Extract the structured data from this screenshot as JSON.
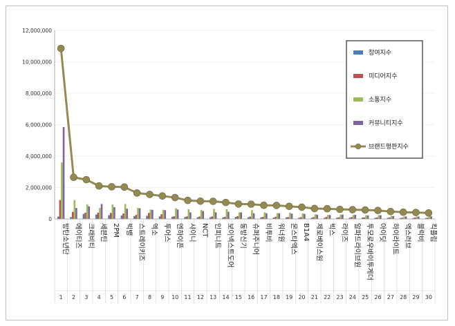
{
  "chart_data": {
    "type": "bar",
    "title": "",
    "xlabel": "",
    "ylabel": "",
    "ylim": [
      0,
      12000000
    ],
    "yticks": [
      0,
      2000000,
      4000000,
      6000000,
      8000000,
      10000000,
      12000000
    ],
    "ytick_labels": [
      "0",
      "2,000,000",
      "4,000,000",
      "6,000,000",
      "8,000,000",
      "10,000,000",
      "12,000,000"
    ],
    "ranks": [
      "1",
      "2",
      "3",
      "4",
      "5",
      "6",
      "7",
      "8",
      "9",
      "10",
      "11",
      "12",
      "13",
      "14",
      "15",
      "16",
      "17",
      "18",
      "19",
      "20",
      "21",
      "22",
      "23",
      "24",
      "25",
      "26",
      "27",
      "28",
      "29",
      "30"
    ],
    "categories": [
      "방탄소년단",
      "에이티즈",
      "크래비티",
      "세븐틴",
      "2PM",
      "빅뱅",
      "스트레이키즈",
      "엑소",
      "투어스",
      "엔하이픈",
      "샤이니",
      "NCT",
      "인피니트",
      "보이넥스트도어",
      "동방신기",
      "슈퍼주니어",
      "비투비",
      "워너원",
      "몬스타엑스",
      "B1A4",
      "제로베이스원",
      "빅스",
      "라이즈",
      "알파드라이브원",
      "투모로우바이투게더",
      "아이딧",
      "하이라이트",
      "엑스러브",
      "블락비",
      "킥플립"
    ],
    "legend_position": "right",
    "series": [
      {
        "name": "참여지수",
        "color": "#4a7ebb",
        "values": [
          150000,
          120000,
          320000,
          280000,
          240000,
          220000,
          180000,
          200000,
          160000,
          140000,
          120000,
          110000,
          110000,
          100000,
          130000,
          110000,
          100000,
          90000,
          100000,
          80000,
          80000,
          70000,
          90000,
          80000,
          90000,
          70000,
          70000,
          60000,
          60000,
          60000
        ]
      },
      {
        "name": "미디어지수",
        "color": "#c0504d",
        "values": [
          1200000,
          450000,
          400000,
          400000,
          380000,
          350000,
          260000,
          380000,
          300000,
          170000,
          160000,
          160000,
          160000,
          130000,
          180000,
          150000,
          130000,
          140000,
          120000,
          110000,
          120000,
          130000,
          100000,
          120000,
          100000,
          90000,
          100000,
          80000,
          90000,
          80000
        ]
      },
      {
        "name": "소통지수",
        "color": "#9bbb59",
        "values": [
          3600000,
          1200000,
          930000,
          700000,
          920000,
          950000,
          700000,
          600000,
          580000,
          680000,
          620000,
          580000,
          640000,
          620000,
          420000,
          560000,
          420000,
          370000,
          400000,
          350000,
          300000,
          260000,
          280000,
          260000,
          240000,
          240000,
          200000,
          160000,
          160000,
          190000
        ]
      },
      {
        "name": "커뮤니티지수",
        "color": "#8064a2",
        "values": [
          5850000,
          700000,
          800000,
          950000,
          750000,
          650000,
          680000,
          580000,
          560000,
          600000,
          420000,
          500000,
          420000,
          460000,
          420000,
          360000,
          360000,
          360000,
          340000,
          320000,
          270000,
          250000,
          280000,
          260000,
          220000,
          240000,
          180000,
          160000,
          150000,
          160000
        ]
      },
      {
        "name": "브랜드평판지수",
        "color": "#938953",
        "values": [
          10850000,
          2650000,
          2500000,
          2100000,
          2050000,
          2030000,
          1650000,
          1560000,
          1460000,
          1360000,
          1180000,
          1130000,
          1120000,
          1050000,
          950000,
          940000,
          870000,
          860000,
          800000,
          750000,
          660000,
          650000,
          610000,
          590000,
          570000,
          540000,
          470000,
          430000,
          410000,
          380000
        ]
      }
    ]
  }
}
